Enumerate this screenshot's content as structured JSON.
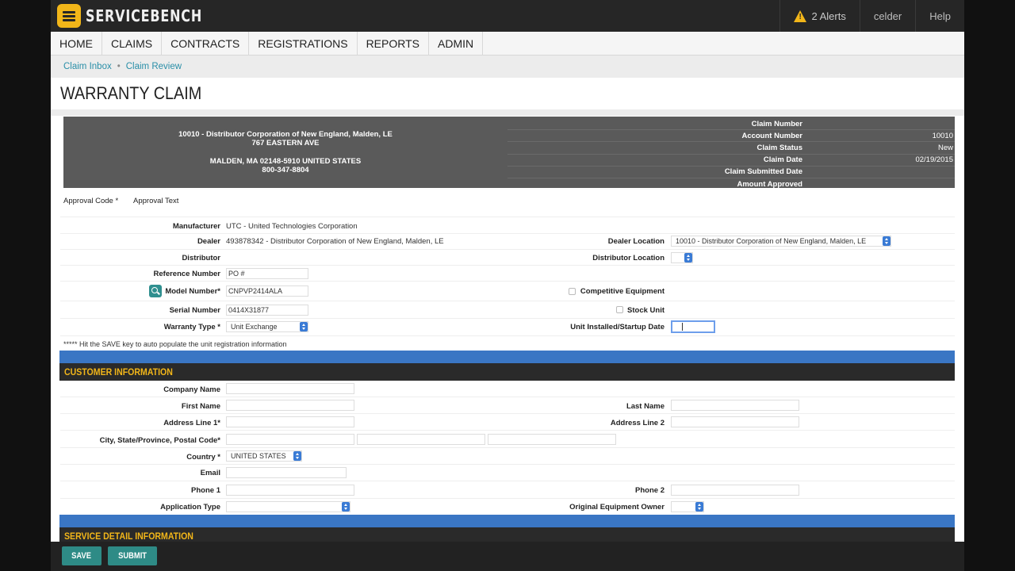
{
  "app": {
    "name": "SERVICEBENCH"
  },
  "topbar": {
    "alerts": "2 Alerts",
    "user": "celder",
    "help": "Help"
  },
  "nav": [
    "HOME",
    "CLAIMS",
    "CONTRACTS",
    "REGISTRATIONS",
    "REPORTS",
    "ADMIN"
  ],
  "breadcrumb": {
    "items": [
      "Claim Inbox",
      "Claim Review"
    ],
    "separator": "•"
  },
  "page_title": "WARRANTY CLAIM",
  "header": {
    "address_line1": "10010 - Distributor Corporation of New England, Malden, LE",
    "address_line2": "767 EASTERN AVE",
    "address_line3": "MALDEN, MA 02148-5910 UNITED STATES",
    "address_line4": "800-347-8804",
    "claim_number_label": "Claim Number",
    "claim_number": "",
    "account_number_label": "Account Number",
    "account_number": "10010",
    "claim_status_label": "Claim Status",
    "claim_status": "New",
    "claim_date_label": "Claim Date",
    "claim_date": "02/19/2015",
    "submitted_date_label": "Claim Submitted Date",
    "submitted_date": "",
    "amount_approved_label": "Amount Approved",
    "amount_approved": ""
  },
  "approval": {
    "code_label": "Approval Code *",
    "text_label": "Approval Text"
  },
  "unit": {
    "manufacturer_label": "Manufacturer",
    "manufacturer": "UTC - United Technologies Corporation",
    "dealer_label": "Dealer",
    "dealer": "493878342 - Distributor Corporation of New England, Malden, LE",
    "dealer_location_label": "Dealer Location",
    "dealer_location": "10010 - Distributor Corporation of New England, Malden, LE",
    "distributor_label": "Distributor",
    "distributor_location_label": "Distributor Location",
    "reference_label": "Reference Number",
    "reference_value": "PO #",
    "model_label": "Model Number*",
    "model_value": "CNPVP2414ALA",
    "competitive_label": "Competitive Equipment",
    "serial_label": "Serial Number",
    "serial_value": "0414X31877",
    "stock_label": "Stock Unit",
    "warranty_type_label": "Warranty Type *",
    "warranty_type": "Unit Exchange",
    "installed_label": "Unit Installed/Startup Date",
    "installed_value": "",
    "note": "***** Hit the SAVE key to auto populate the unit registration information"
  },
  "customer": {
    "section_title": "CUSTOMER INFORMATION",
    "company_label": "Company Name",
    "first_name_label": "First Name",
    "last_name_label": "Last Name",
    "address1_label": "Address Line 1*",
    "address2_label": "Address Line 2",
    "city_label": "City, State/Province, Postal Code*",
    "country_label": "Country *",
    "country": "UNITED STATES",
    "email_label": "Email",
    "phone1_label": "Phone 1",
    "phone2_label": "Phone 2",
    "application_label": "Application Type",
    "oeo_label": "Original Equipment Owner"
  },
  "service": {
    "section_title": "SERVICE DETAIL INFORMATION"
  },
  "actions": {
    "save": "SAVE",
    "submit": "SUBMIT"
  },
  "colors": {
    "accent": "#f2b619",
    "teal": "#2e8b86",
    "blue_band": "#3a76c4",
    "link": "#2a8fa8"
  }
}
